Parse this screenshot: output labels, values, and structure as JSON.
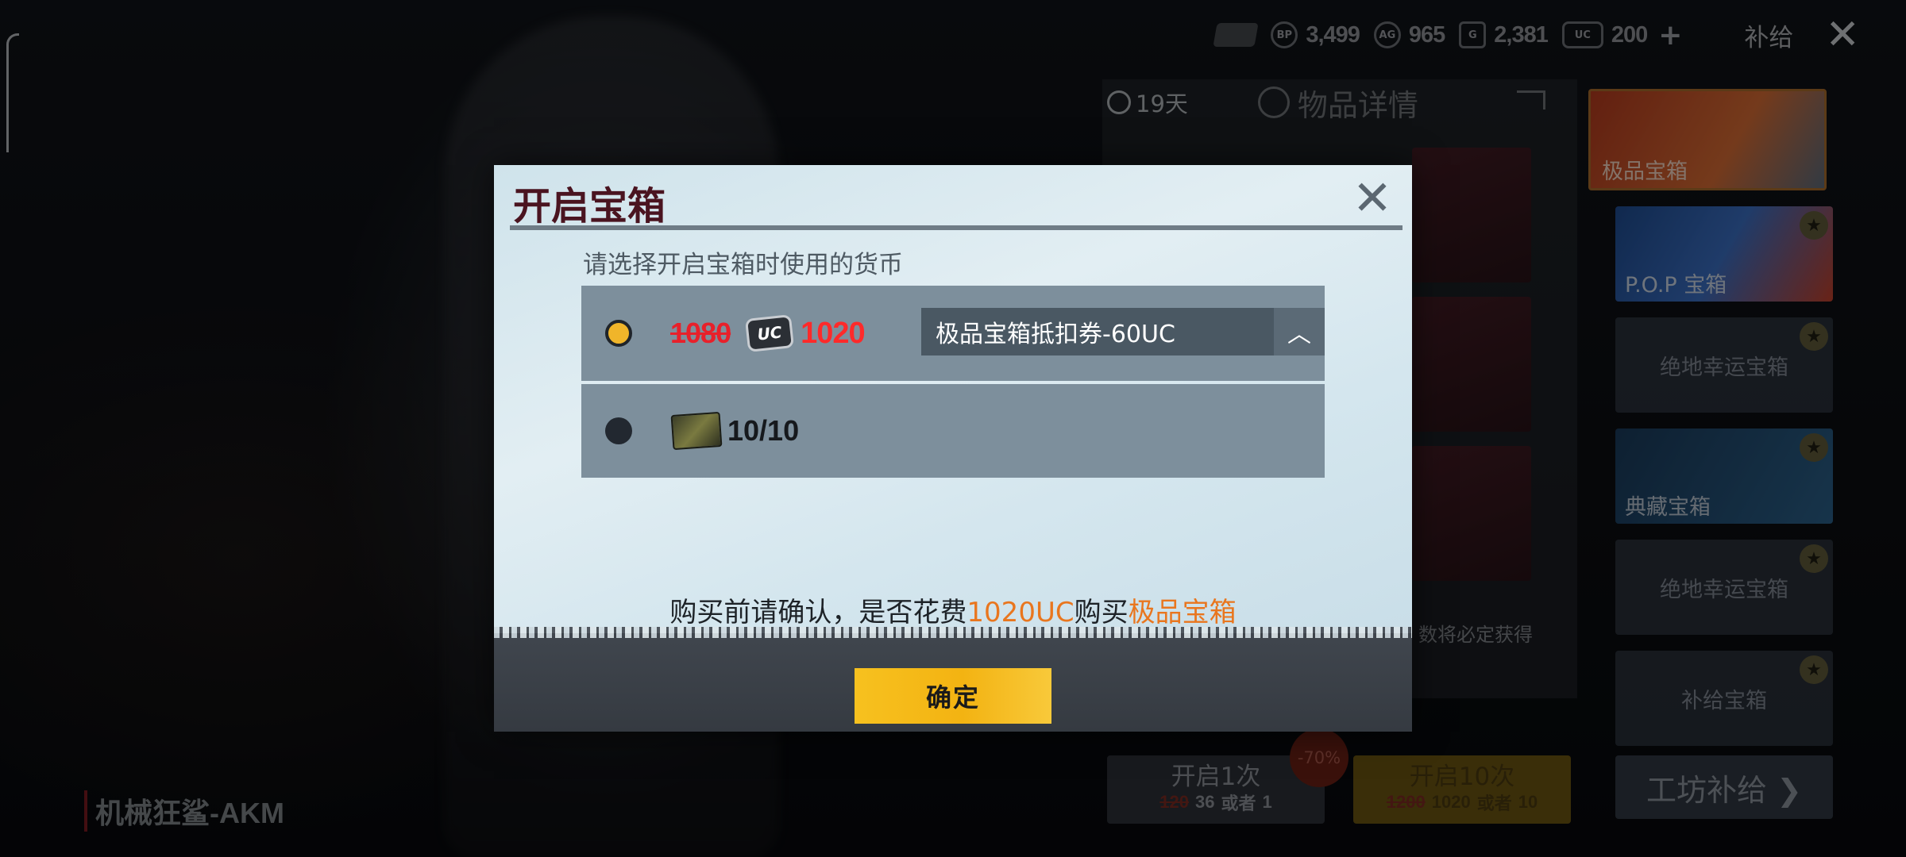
{
  "topbar": {
    "currencies": [
      {
        "icon": "bp-coin-icon",
        "icon_text": "BP",
        "value": "3,499"
      },
      {
        "icon": "ag-coin-icon",
        "icon_text": "AG",
        "value": "965"
      },
      {
        "icon": "g-coin-icon",
        "icon_text": "G",
        "value": "2,381"
      },
      {
        "icon": "uc-coin-icon",
        "icon_text": "UC",
        "value": "200"
      }
    ],
    "plus": "+",
    "supply_label": "补给",
    "close_symbol": "✕"
  },
  "detail_panel": {
    "timer": "19天",
    "title": "物品详情",
    "guarantee_text": "数将必定获得"
  },
  "crates": [
    {
      "name": "极品宝箱",
      "style": "featured"
    },
    {
      "name": "P.O.P 宝箱",
      "style": "pop"
    },
    {
      "name": "绝地幸运宝箱",
      "style": "plain"
    },
    {
      "name": "典藏宝箱",
      "style": "hot"
    },
    {
      "name": "绝地幸运宝箱",
      "style": "plain"
    },
    {
      "name": "补给宝箱",
      "style": "plain"
    }
  ],
  "workshop_button": "工坊补给 ❯",
  "open_once": {
    "label": "开启1次",
    "old_price": "120",
    "price": "36",
    "or": "或者",
    "tickets": "1"
  },
  "open_ten": {
    "label": "开启10次",
    "old_price": "1200",
    "price": "1020",
    "or": "或者",
    "tickets": "10"
  },
  "discount_badge": "-70%",
  "weapon_name": "机械狂鲨-AKM",
  "modal": {
    "title": "开启宝箱",
    "close_symbol": "✕",
    "prompt": "请选择开启宝箱时使用的货币",
    "option_uc": {
      "selected": true,
      "old_price": "1080",
      "currency_icon_text": "UC",
      "price": "1020",
      "coupon": "极品宝箱抵扣券-60UC",
      "coupon_arrow": "︿"
    },
    "option_ticket": {
      "selected": false,
      "count": "10/10"
    },
    "confirm_prefix": "购买前请确认，是否花费",
    "confirm_amount": "1020UC",
    "confirm_mid": "购买",
    "confirm_item": "极品宝箱",
    "confirm_button": "确定"
  },
  "colors": {
    "accent_yellow": "#f3b312",
    "price_red": "#ff2a2a",
    "highlight_orange": "#e9761e",
    "title_maroon": "#4a1420"
  }
}
